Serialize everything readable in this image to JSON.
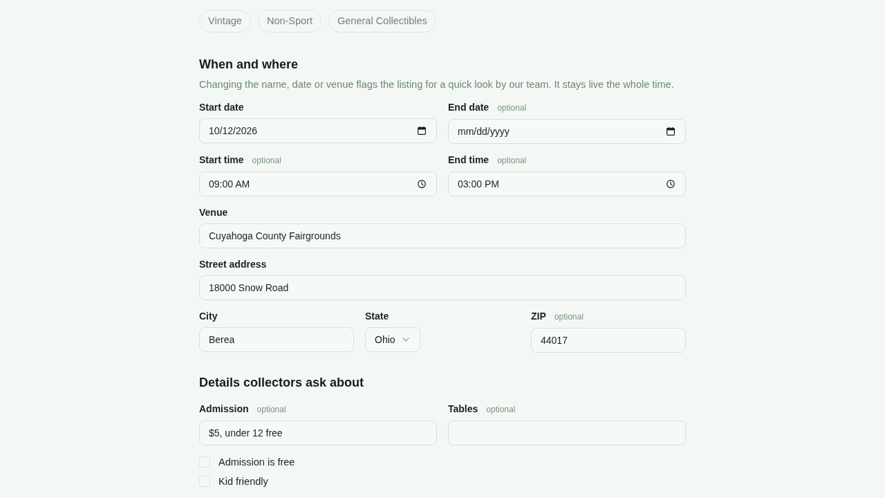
{
  "tags": [
    {
      "label": "Vintage",
      "selected": false
    },
    {
      "label": "Non-Sport",
      "selected": false
    },
    {
      "label": "General Collectibles",
      "selected": false
    }
  ],
  "sections": [
    {
      "title": "When and where",
      "description": "Changing the name, date or venue flags the listing for a quick look by our team. It stays live the whole time.",
      "rows": [
        [
          {
            "kind": "date",
            "label": "Start date",
            "value": "10/12/2026"
          },
          {
            "kind": "date",
            "label": "End date",
            "hint": "optional",
            "placeholder": "mm/dd/yyyy"
          }
        ],
        [
          {
            "kind": "time",
            "label": "Start time",
            "hint": "optional",
            "value": "09:00 AM"
          },
          {
            "kind": "time",
            "label": "End time",
            "hint": "optional",
            "value": "03:00 PM"
          }
        ],
        [
          {
            "kind": "text",
            "label": "Venue",
            "value": "Cuyahoga County Fairgrounds"
          }
        ],
        [
          {
            "kind": "text",
            "label": "Street address",
            "value": "18000 Snow Road"
          }
        ],
        [
          {
            "kind": "text",
            "label": "City",
            "value": "Berea"
          },
          {
            "kind": "select",
            "label": "State",
            "value": "Ohio"
          },
          {
            "kind": "text",
            "label": "ZIP",
            "hint": "optional",
            "value": "44017"
          }
        ]
      ]
    },
    {
      "title": "Details collectors ask about",
      "rows": [
        [
          {
            "kind": "text",
            "label": "Admission",
            "hint": "optional",
            "value": "$5, under 12 free"
          },
          {
            "kind": "text",
            "label": "Tables",
            "hint": "optional"
          }
        ]
      ],
      "checkboxes": [
        {
          "label": "Admission is free",
          "checked": false
        },
        {
          "label": "Kid friendly",
          "checked": false
        }
      ]
    }
  ]
}
